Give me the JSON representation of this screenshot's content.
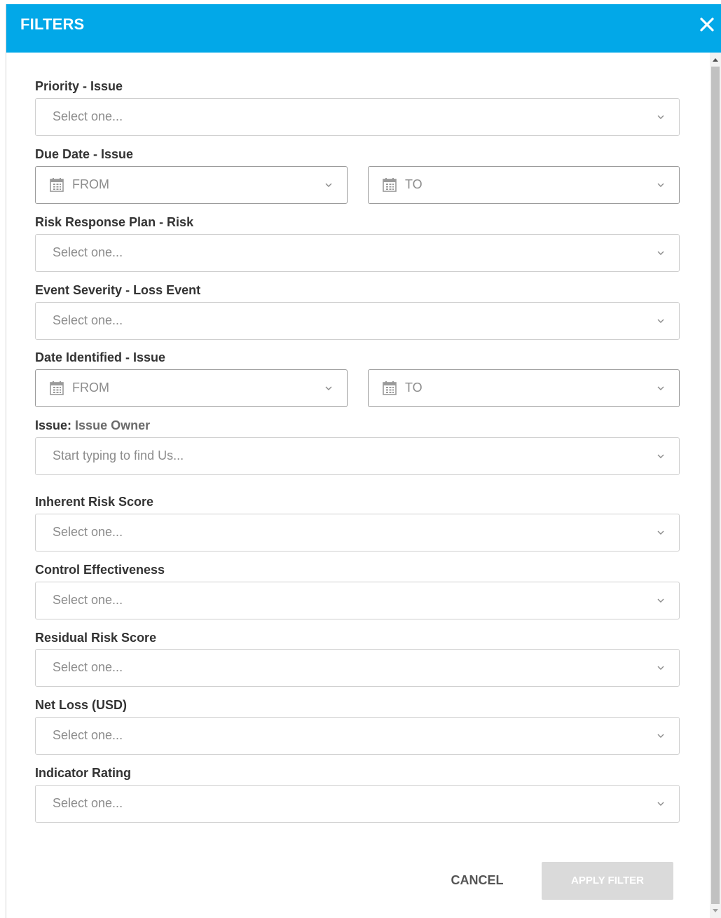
{
  "header": {
    "title": "FILTERS",
    "close_icon": "close-icon"
  },
  "fields": {
    "priority": {
      "label": "Priority - Issue",
      "placeholder": "Select one..."
    },
    "due_date": {
      "label": "Due Date - Issue",
      "from": "FROM",
      "to": "TO"
    },
    "risk_response": {
      "label": "Risk Response Plan - Risk",
      "placeholder": "Select one..."
    },
    "event_severity": {
      "label": "Event Severity - Loss Event",
      "placeholder": "Select one..."
    },
    "date_identified": {
      "label": "Date Identified - Issue",
      "from": "FROM",
      "to": "TO"
    },
    "issue_owner": {
      "label_prefix": "Issue:",
      "label_suffix": "Issue Owner",
      "placeholder": "Start typing to find Us..."
    },
    "inherent_risk": {
      "label": "Inherent Risk Score",
      "placeholder": "Select one..."
    },
    "control_effectiveness": {
      "label": "Control Effectiveness",
      "placeholder": "Select one..."
    },
    "residual_risk": {
      "label": "Residual Risk Score",
      "placeholder": "Select one..."
    },
    "net_loss": {
      "label": "Net Loss (USD)",
      "placeholder": "Select one..."
    },
    "indicator_rating": {
      "label": "Indicator Rating",
      "placeholder": "Select one..."
    }
  },
  "footer": {
    "cancel_label": "CANCEL",
    "apply_label": "APPLY FILTER"
  },
  "colors": {
    "header_bg": "#02a8e8",
    "apply_disabled_bg": "#dadada"
  }
}
